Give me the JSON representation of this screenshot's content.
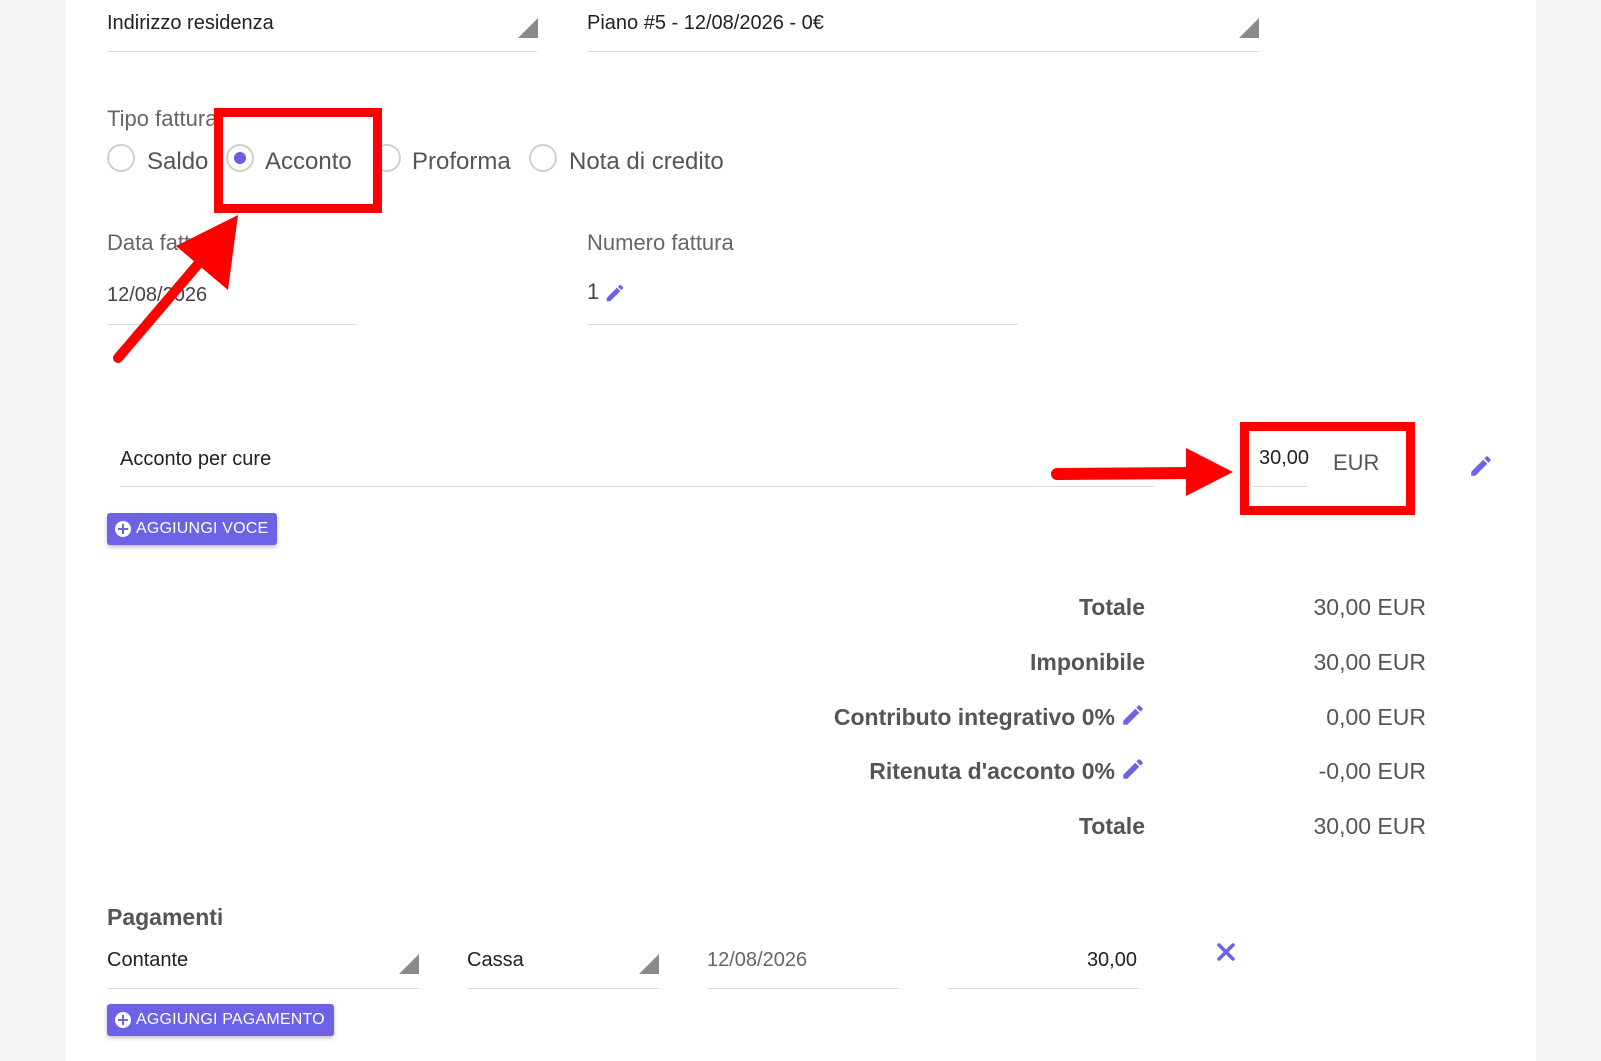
{
  "address": {
    "residence_select": "Indirizzo residenza",
    "plan_select": "Piano #5 - 12/08/2026 - 0€"
  },
  "invoice_type": {
    "label": "Tipo fattura",
    "options": [
      "Saldo",
      "Acconto",
      "Proforma",
      "Nota di credito"
    ],
    "selected": "Acconto"
  },
  "invoice_date": {
    "label": "Data fattura",
    "value": "12/08/2026"
  },
  "invoice_number": {
    "label": "Numero fattura",
    "value": "1"
  },
  "line_item": {
    "description": "Acconto per cure",
    "amount": "30,00",
    "currency": "EUR"
  },
  "add_item_button": "AGGIUNGI VOCE",
  "totals": [
    {
      "label": "Totale",
      "value": "30,00 EUR"
    },
    {
      "label": "Imponibile",
      "value": "30,00 EUR"
    },
    {
      "label": "Contributo integrativo 0%",
      "value": "0,00 EUR"
    },
    {
      "label": "Ritenuta d'acconto 0%",
      "value": "-0,00 EUR"
    },
    {
      "label": "Totale",
      "value": "30,00 EUR"
    }
  ],
  "payments": {
    "title": "Pagamenti",
    "row": {
      "method": "Contante",
      "account": "Cassa",
      "date": "12/08/2026",
      "amount": "30,00"
    },
    "add_button": "AGGIUNGI PAGAMENTO"
  },
  "colors": {
    "accent": "#6d62e6",
    "annotation": "#ff0000"
  },
  "icons": [
    "chevron-down-icon",
    "pencil-icon",
    "plus-circle-icon",
    "close-icon",
    "arrow-icon"
  ]
}
